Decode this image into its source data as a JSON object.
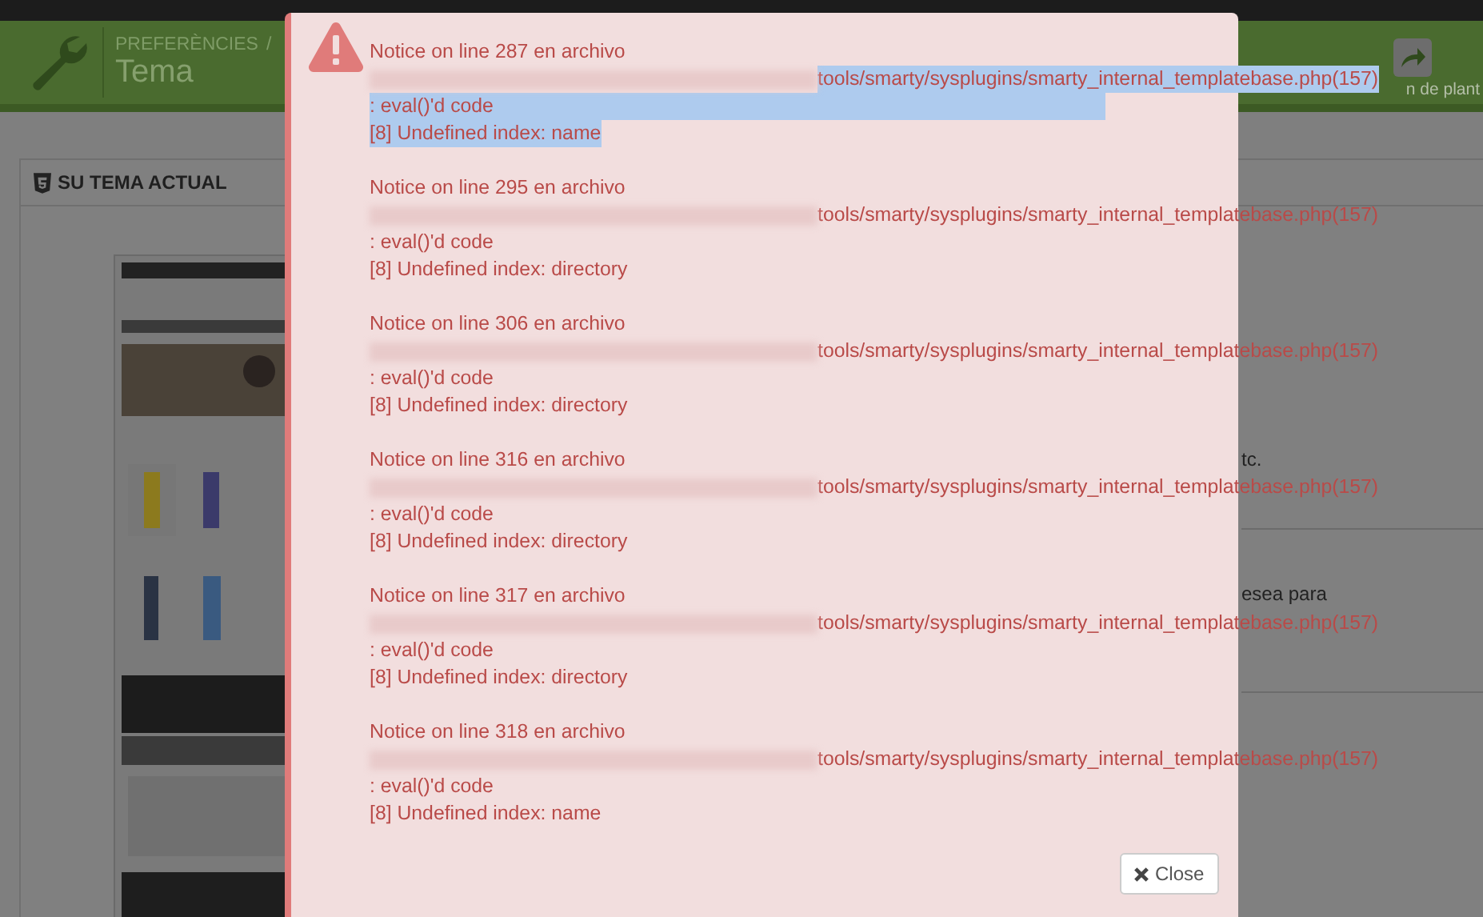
{
  "header": {
    "breadcrumb": [
      "PREFERÈNCIES",
      "/"
    ],
    "title": "Tema",
    "action_label": "n de plant"
  },
  "panel": {
    "heading": "SU TEMA ACTUAL",
    "rows": [
      "tc.",
      "esea para"
    ]
  },
  "dialog": {
    "notices": [
      {
        "title": "Notice on line 287 en archivo",
        "path": "tools/smarty/sysplugins/smarty_internal_templatebase.php(157)",
        "context": ": eval()'d code",
        "message": "[8] Undefined index: name",
        "selected": true
      },
      {
        "title": "Notice on line 295 en archivo",
        "path": "tools/smarty/sysplugins/smarty_internal_templatebase.php(157)",
        "context": ": eval()'d code",
        "message": "[8] Undefined index: directory",
        "selected": false
      },
      {
        "title": "Notice on line 306 en archivo",
        "path": "tools/smarty/sysplugins/smarty_internal_templatebase.php(157)",
        "context": ": eval()'d code",
        "message": "[8] Undefined index: directory",
        "selected": false
      },
      {
        "title": "Notice on line 316 en archivo",
        "path": "tools/smarty/sysplugins/smarty_internal_templatebase.php(157)",
        "context": ": eval()'d code",
        "message": "[8] Undefined index: directory",
        "selected": false
      },
      {
        "title": "Notice on line 317 en archivo",
        "path": "tools/smarty/sysplugins/smarty_internal_templatebase.php(157)",
        "context": ": eval()'d code",
        "message": "[8] Undefined index: directory",
        "selected": false
      },
      {
        "title": "Notice on line 318 en archivo",
        "path": "tools/smarty/sysplugins/smarty_internal_templatebase.php(157)",
        "context": ": eval()'d code",
        "message": "[8] Undefined index: name",
        "selected": false
      }
    ],
    "close_button": "Close"
  }
}
